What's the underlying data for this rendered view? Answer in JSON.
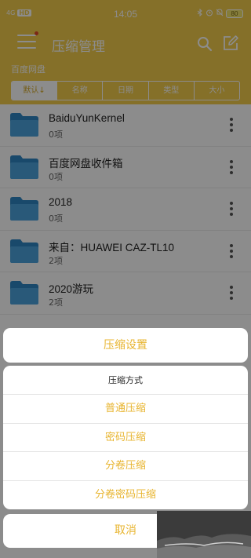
{
  "status_bar": {
    "left": "4G",
    "hd": "HD",
    "time": "14:05",
    "icons": [
      "bluetooth-icon",
      "alarm-icon",
      "mute-icon"
    ],
    "battery": "80"
  },
  "app_bar": {
    "title": "压缩管理",
    "menu_icon": "menu-icon",
    "search_icon": "search-icon",
    "edit_icon": "edit-icon"
  },
  "breadcrumb": "百度网盘",
  "sort_tabs": [
    "默认↓",
    "名称",
    "日期",
    "类型",
    "大小"
  ],
  "files": [
    {
      "name": "BaiduYunKernel",
      "count": "0项"
    },
    {
      "name": "百度网盘收件箱",
      "count": "0项"
    },
    {
      "name": "2018",
      "count": "0项"
    },
    {
      "name": "来自：HUAWEI CAZ-TL10",
      "count": "2项"
    },
    {
      "name": "2020游玩",
      "count": "2项"
    }
  ],
  "sheet": {
    "title": "压缩设置",
    "subtitle": "压缩方式",
    "options": [
      "普通压缩",
      "密码压缩",
      "分卷压缩",
      "分卷密码压缩"
    ],
    "cancel": "取消"
  },
  "colors": {
    "accent": "#f3cc4b",
    "sheet_text": "#e8b530",
    "folder": "#3f97d3"
  }
}
